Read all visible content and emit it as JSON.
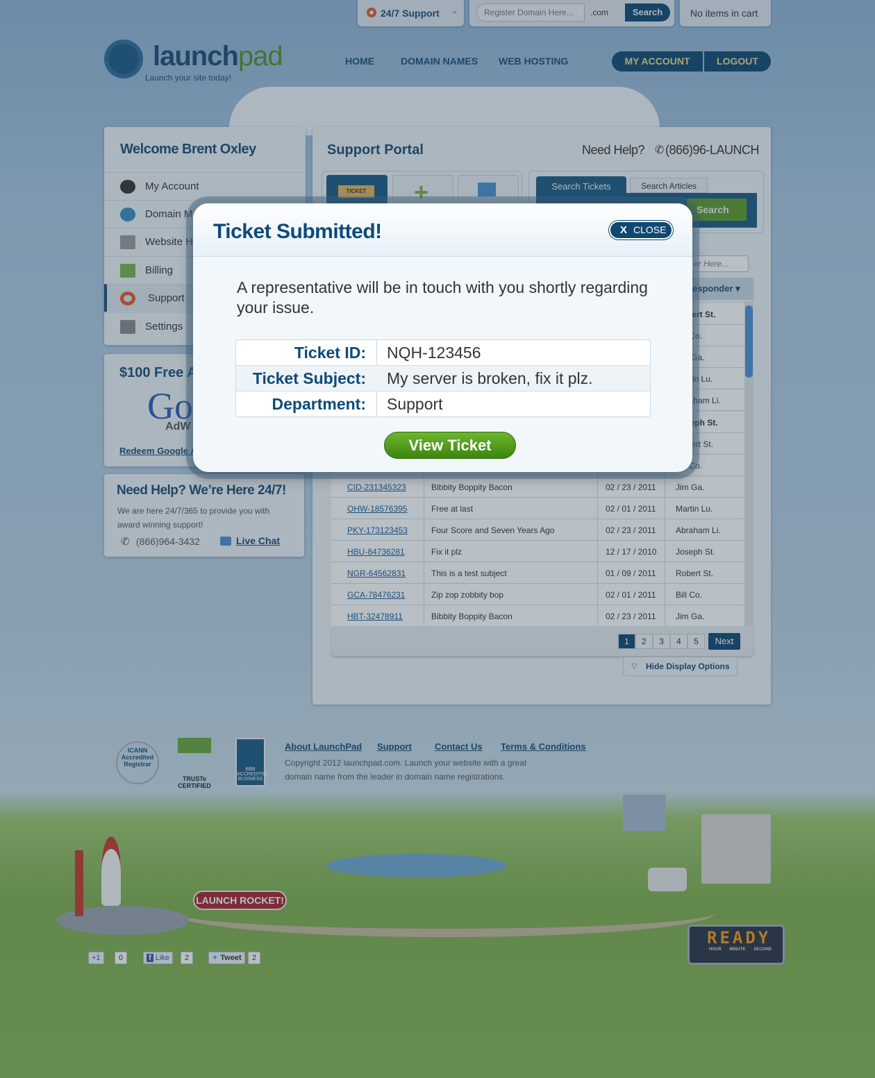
{
  "topbar": {
    "support_label": "24/7 Support",
    "domain_placeholder": "Register Domain Here...",
    "tld": ".com",
    "search_label": "Search",
    "cart": "No items in cart"
  },
  "logo": {
    "name_a": "launch",
    "name_b": "pad",
    "tagline": "Launch your site today!"
  },
  "nav": [
    "HOME",
    "DOMAIN NAMES",
    "WEB HOSTING"
  ],
  "account": {
    "my_account": "MY ACCOUNT",
    "logout": "LOGOUT"
  },
  "sidebar": {
    "welcome": "Welcome Brent Oxley",
    "items": [
      {
        "label": "My Account"
      },
      {
        "label": "Domain M"
      },
      {
        "label": "Website H"
      },
      {
        "label": "Billing"
      },
      {
        "label": "Support",
        "active": true
      },
      {
        "label": "Settings"
      }
    ]
  },
  "ad": {
    "title": "$100 Free Ac",
    "logo_text": "Go",
    "logo_sub": "AdW",
    "link": "Redeem Google A"
  },
  "help": {
    "title": "Need Help? We’re Here 24/7!",
    "text": "We are here 24/7/365 to provide you with award winning support!",
    "phone": "(866)964-3432",
    "chat": "Live Chat"
  },
  "portal": {
    "title": "Support Portal",
    "need_help": "Need Help?",
    "phone": "(866)96-LAUNCH",
    "ticket_icon_text": "TICKET",
    "tabs": [
      "Search Tickets",
      "Search Articles"
    ],
    "search_button": "Search",
    "filter_placeholder": "er Here...",
    "responder_header": "esponder ▾"
  },
  "tickets": [
    {
      "id": "",
      "subject": "",
      "date": "",
      "responder": "Robert St.",
      "bold": true
    },
    {
      "id": "",
      "subject": "",
      "date": "",
      "responder": "Bill Co."
    },
    {
      "id": "",
      "subject": "",
      "date": "",
      "responder": "Jim Ga."
    },
    {
      "id": "",
      "subject": "",
      "date": "",
      "responder": "Martin Lu."
    },
    {
      "id": "",
      "subject": "",
      "date": "",
      "responder": "Abraham Li."
    },
    {
      "id": "",
      "subject": "",
      "date": "",
      "responder": "Joseph St.",
      "bold": true
    },
    {
      "id": "",
      "subject": "",
      "date": "",
      "responder": "Robert St."
    },
    {
      "id": "",
      "subject": "",
      "date": "",
      "responder": "Bill Co."
    },
    {
      "id": "CID-231345323",
      "subject": "Bibbity Boppity Bacon",
      "date": "02 / 23 / 2011",
      "responder": "Jim Ga."
    },
    {
      "id": "OHW-18576395",
      "subject": "Free at last",
      "date": "02 / 01 / 2011",
      "responder": "Martin Lu."
    },
    {
      "id": "PKY-173123453",
      "subject": "Four Score and Seven Years Ago",
      "date": "02 / 23 / 2011",
      "responder": "Abraham Li."
    },
    {
      "id": "HBU-84736281",
      "subject": "Fix it plz",
      "date": "12 / 17 / 2010",
      "responder": "Joseph St."
    },
    {
      "id": "NGR-64562831",
      "subject": "This is a test subject",
      "date": "01 / 09 / 2011",
      "responder": "Robert St."
    },
    {
      "id": "GCA-78476231",
      "subject": "Zip zop zobbity bop",
      "date": "02 / 01 / 2011",
      "responder": "Bill Co."
    },
    {
      "id": "HBT-32478911",
      "subject": "Bibbity Boppity Bacon",
      "date": "02 / 23 / 2011",
      "responder": "Jim Ga."
    }
  ],
  "pagination": {
    "pages": [
      "1",
      "2",
      "3",
      "4",
      "5"
    ],
    "current": "1",
    "next": "Next"
  },
  "hide_options": "Hide Display Options",
  "footer": {
    "links": [
      "About LaunchPad",
      "Support",
      "Contact Us",
      "Terms & Conditions"
    ],
    "copyright1": "Copyright 2012 launchpad.com. Launch your website with a great",
    "copyright2": "domain name from the leader in domain name registrations.",
    "badges": [
      "ICANN Accredited Registrar",
      "TRUSTe CERTIFIED",
      "BBB ACCREDITED BUSINESS"
    ]
  },
  "scene": {
    "launch_button": "LAUNCH ROCKET!",
    "clock": "READY",
    "clock_labels": [
      "HOUR",
      "MINUTE",
      "SECOND"
    ]
  },
  "social": {
    "gplus": "+1",
    "gplus_count": "0",
    "like": "Like",
    "like_count": "2",
    "tweet": "Tweet",
    "tweet_count": "2"
  },
  "modal": {
    "title": "Ticket Submitted!",
    "close": "CLOSE",
    "message": "A representative will be in touch with you shortly regarding your issue.",
    "fields": [
      {
        "label": "Ticket ID:",
        "value": "NQH-123456"
      },
      {
        "label": "Ticket Subject:",
        "value": "My server is broken, fix it plz."
      },
      {
        "label": "Department:",
        "value": "Support"
      }
    ],
    "button": "View Ticket"
  },
  "colors": {
    "brand_blue": "#0f4870",
    "accent_green": "#4a9a1a",
    "link": "#1b5a93"
  }
}
